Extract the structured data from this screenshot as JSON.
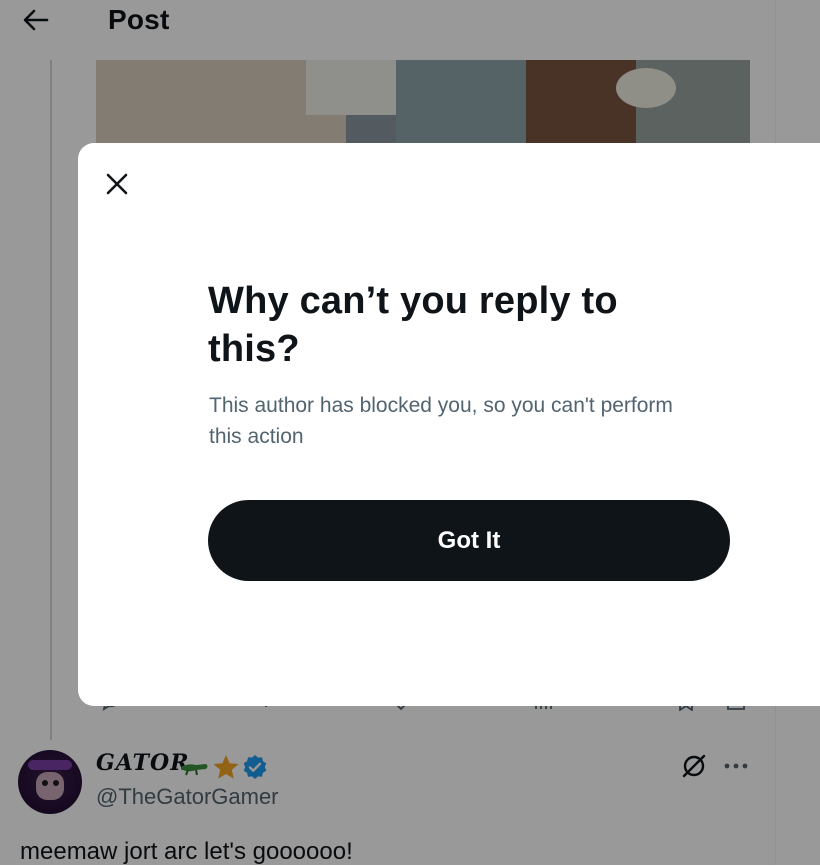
{
  "header": {
    "title": "Post"
  },
  "tweet": {
    "display_name": "GATOR",
    "emoji": [
      "crocodile-icon",
      "star-icon",
      "verified-badge-icon"
    ],
    "handle": "@TheGatorGamer",
    "text": "meemaw jort arc let's goooooo!"
  },
  "modal": {
    "title": "Why can’t you reply to this?",
    "body": "This author has blocked you, so you can't perform this action",
    "button_label": "Got It"
  },
  "colors": {
    "text_primary": "#0f1419",
    "text_secondary": "#536471",
    "button_bg": "#0f1419",
    "verified": "#1d9bf0",
    "star": "#f4a623",
    "crocodile": "#3a8f3a",
    "backdrop": "rgba(0,0,0,0.4)"
  }
}
